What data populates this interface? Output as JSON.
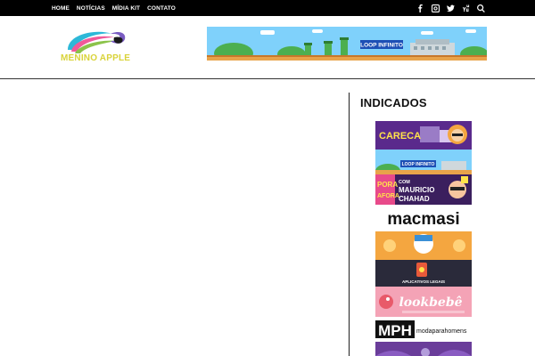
{
  "nav": {
    "items": [
      "HOME",
      "NOTÍCIAS",
      "MÍDIA KIT",
      "CONTATO"
    ]
  },
  "social_icons": [
    "facebook-icon",
    "instagram-icon",
    "twitter-icon",
    "youtube-icon",
    "search-icon"
  ],
  "header": {
    "logo_text": "MENINO APPLE",
    "banner_label": "LOOP INFINITO"
  },
  "sidebar": {
    "title": "INDICADOS",
    "ads": {
      "careca": "CARECA",
      "loop": "LOOP INFINITO",
      "porafora_line1": "PORA",
      "porafora_line2": "AFORA",
      "porafora_com": "COM",
      "porafora_name1": "MAURICIO",
      "porafora_name2": "CHAHAD",
      "macmasi": "macmasi",
      "apps": "APLICATIVOS LEGAIS",
      "lookbebe": "lookbebê",
      "mph": "MPH",
      "mph_text": "modaparahomens"
    }
  },
  "colors": {
    "topbar": "#000000",
    "logo_text": "#d9d33a",
    "accent_purple": "#6a3d9a"
  }
}
